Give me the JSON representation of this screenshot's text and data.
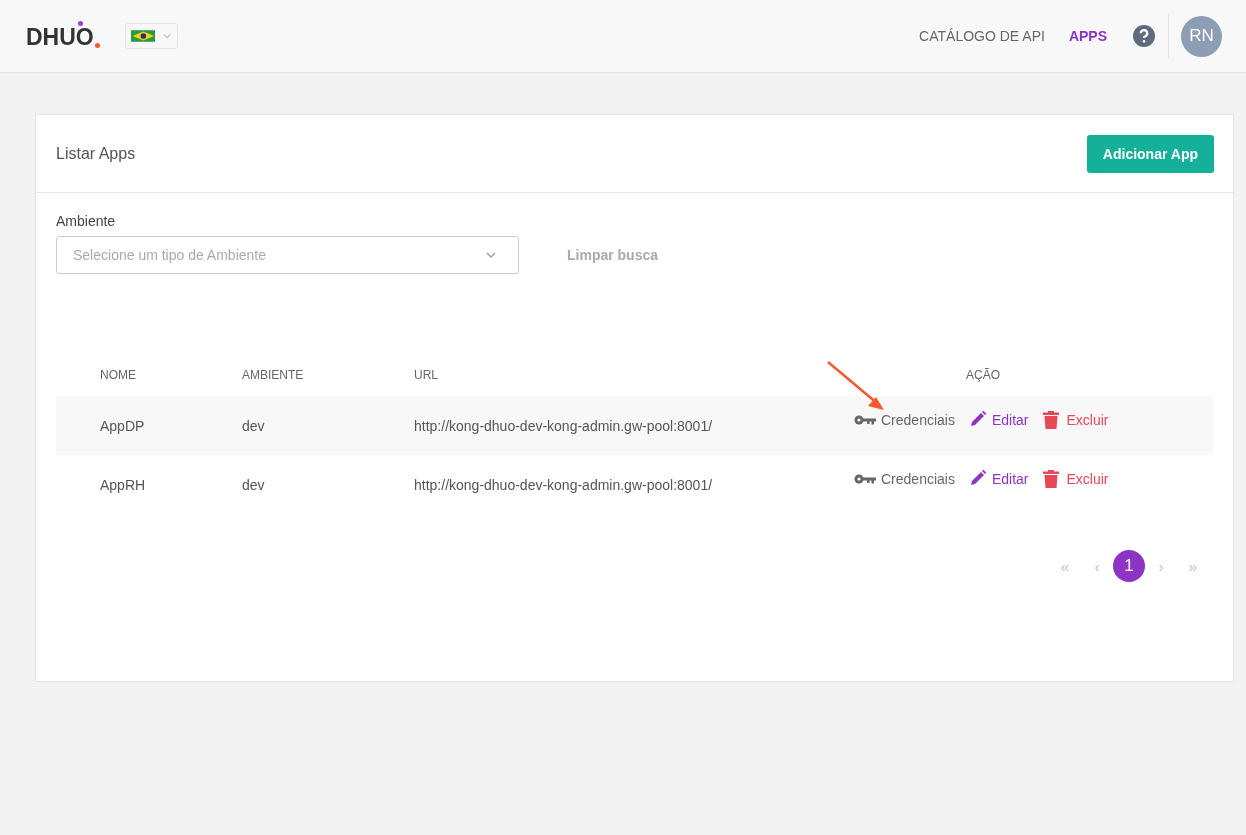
{
  "header": {
    "logo": "DHUO",
    "nav": [
      {
        "label": "CATÁLOGO DE API",
        "selected": false
      },
      {
        "label": "APPS",
        "selected": true
      }
    ],
    "avatar": "RN"
  },
  "card": {
    "title": "Listar Apps",
    "add_button": "Adicionar App",
    "filter": {
      "label": "Ambiente",
      "placeholder": "Selecione um tipo de Ambiente",
      "clear": "Limpar busca"
    },
    "table": {
      "columns": [
        "NOME",
        "AMBIENTE",
        "URL",
        "AÇÃO"
      ],
      "rows": [
        {
          "name": "AppDP",
          "environment": "dev",
          "url": "http://kong-dhuo-dev-kong-admin.gw-pool:8001/",
          "actions": [
            "Credenciais",
            "Editar",
            "Excluir"
          ]
        },
        {
          "name": "AppRH",
          "environment": "dev",
          "url": "http://kong-dhuo-dev-kong-admin.gw-pool:8001/",
          "actions": [
            "Credenciais",
            "Editar",
            "Excluir"
          ]
        }
      ]
    },
    "pagination": [
      {
        "label": "«",
        "kind": "nav",
        "selected": false
      },
      {
        "label": "‹",
        "kind": "nav",
        "selected": false
      },
      {
        "label": "1",
        "kind": "page",
        "selected": true
      },
      {
        "label": "›",
        "kind": "nav",
        "selected": false
      },
      {
        "label": "»",
        "kind": "nav",
        "selected": false
      }
    ]
  }
}
